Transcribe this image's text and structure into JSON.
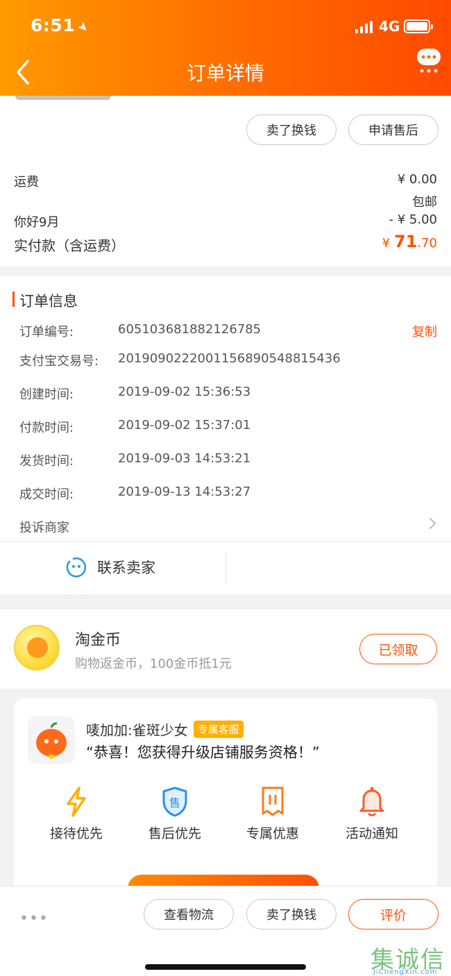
{
  "status_bar": {
    "time": "6:51",
    "network": "4G"
  },
  "header": {
    "title": "订单详情"
  },
  "actions_top": {
    "sell_label": "卖了换钱",
    "after_sales_label": "申请售后"
  },
  "fees": {
    "shipping_label": "运费",
    "shipping_value": "¥ 0.00",
    "shipping_note": "包邮",
    "discount_label": "你好9月",
    "discount_value": "- ¥ 5.00",
    "paid_label": "实付款（含运费）",
    "paid_currency": "¥ ",
    "paid_int": "71",
    "paid_dec": ".70"
  },
  "order_info": {
    "title": "订单信息",
    "copy_label": "复制",
    "rows": [
      {
        "label": "订单编号:",
        "value": "605103681882126785"
      },
      {
        "label": "支付宝交易号:",
        "value": "2019090222001156890548815436"
      },
      {
        "label": "创建时间:",
        "value": "2019-09-02 15:36:53"
      },
      {
        "label": "付款时间:",
        "value": "2019-09-02 15:37:01"
      },
      {
        "label": "发货时间:",
        "value": "2019-09-03 14:53:21"
      },
      {
        "label": "成交时间:",
        "value": "2019-09-13 14:53:27"
      }
    ],
    "complaint_label": "投诉商家",
    "contact_label": "联系卖家"
  },
  "coins": {
    "title": "淘金币",
    "subtitle": "购物返金币，100金币抵1元",
    "button_label": "已领取"
  },
  "shop_card": {
    "name": "唛加加:雀斑少女",
    "badge": "专属客服",
    "message": "“恭喜！您获得升级店铺服务资格！”",
    "perks": [
      {
        "label": "接待优先",
        "icon": "lightning-icon"
      },
      {
        "label": "售后优先",
        "icon": "shield-icon"
      },
      {
        "label": "专属优惠",
        "icon": "coupon-icon"
      },
      {
        "label": "活动通知",
        "icon": "bell-icon"
      }
    ]
  },
  "bottom_bar": {
    "more": "•••",
    "logistics_label": "查看物流",
    "sell_label": "卖了换钱",
    "review_label": "评价"
  },
  "watermark": {
    "chars": "集诚信",
    "url": "JiChengXin.com"
  },
  "colors": {
    "accent": "#ff5000",
    "header_start": "#ff9a00",
    "header_end": "#ff4a00",
    "perk_orange": "#ff7a1a",
    "perk_blue": "#2f8fe0"
  }
}
